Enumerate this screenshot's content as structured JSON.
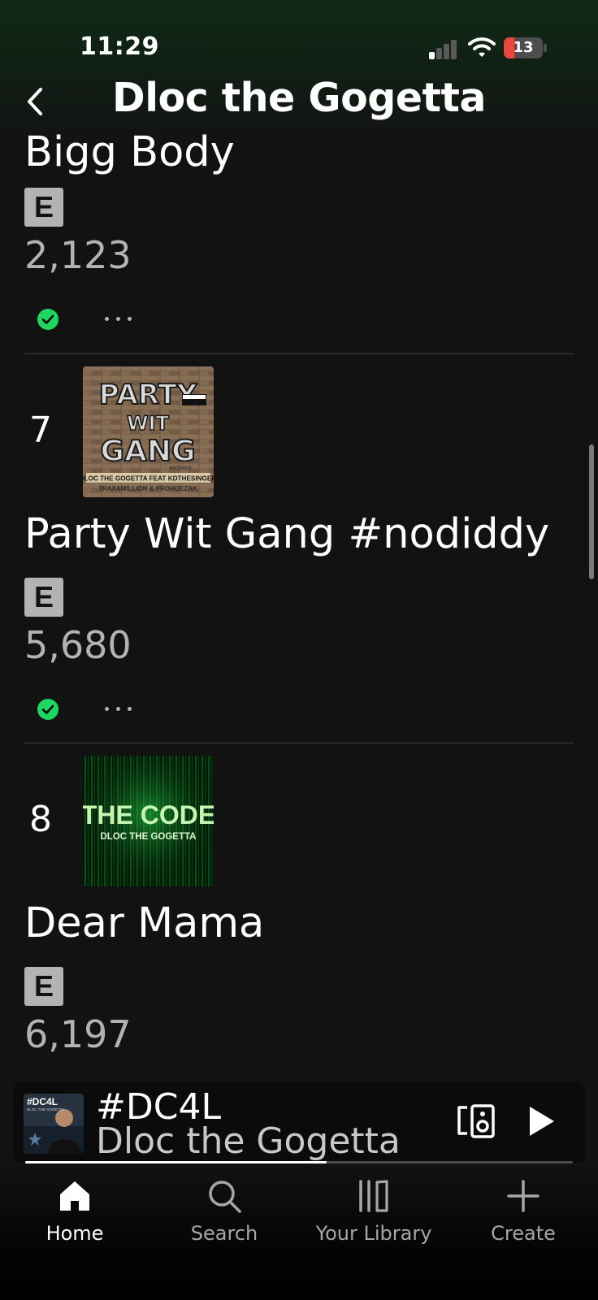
{
  "status_bar": {
    "time": "11:29",
    "battery": "13"
  },
  "header": {
    "title": "Dloc the Gogetta"
  },
  "tracks": [
    {
      "number": "",
      "title": "Bigg Body",
      "explicit": "E",
      "plays": "2,123",
      "saved": true
    },
    {
      "number": "7",
      "title": "Party Wit Gang #nodiddy",
      "explicit": "E",
      "plays": "5,680",
      "saved": true,
      "cover": {
        "line1": "PARTY",
        "line2": "WIT",
        "line3": "GANG",
        "tag": "#NODIDDY",
        "credit1": "DLOC THE GOGETTA FEAT KDTHESINGER",
        "credit2": "TRAXAMILLION & PROHOEZAK",
        "advisory": "PARENTAL ADVISORY EXPLICIT CONTENT"
      }
    },
    {
      "number": "8",
      "title": "Dear Mama",
      "explicit": "E",
      "plays": "6,197",
      "cover": {
        "line1": "THE CODE",
        "line2": "DLOC THE GOGETTA"
      }
    }
  ],
  "now_playing": {
    "title": "#DC4L",
    "artist": "Dloc the Gogetta",
    "cover_text": "#DC4L",
    "cover_sub": "DLOC THE GOGETTA",
    "progress": 0.55
  },
  "nav": {
    "items": [
      {
        "label": "Home",
        "icon": "home-icon",
        "active": true
      },
      {
        "label": "Search",
        "icon": "search-icon",
        "active": false
      },
      {
        "label": "Your Library",
        "icon": "library-icon",
        "active": false
      },
      {
        "label": "Create",
        "icon": "plus-icon",
        "active": false
      }
    ]
  },
  "colors": {
    "accent": "#1ed760",
    "background": "#121212",
    "secondary_text": "#b3b3b3"
  }
}
